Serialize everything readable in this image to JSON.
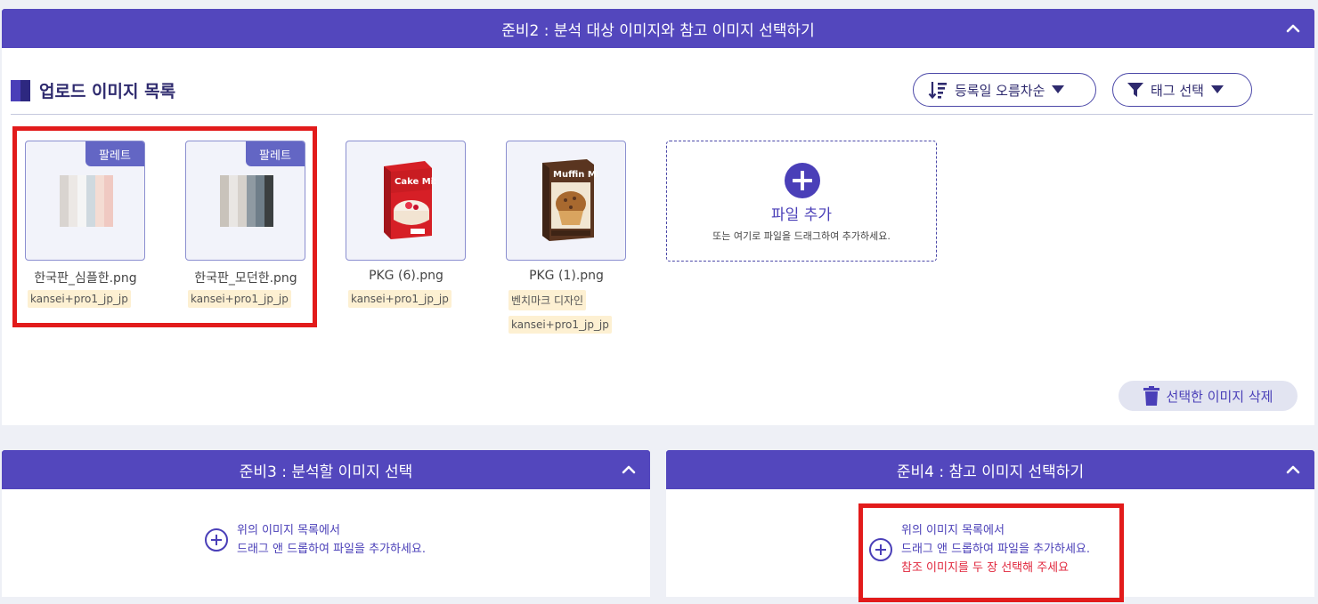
{
  "prep2": {
    "title": "준비2 : 분석 대상 이미지와 참고 이미지 선택하기",
    "section_title": "업로드 이미지 목록",
    "sort_label": "등록일 오름차순",
    "tag_filter_label": "태그 선택",
    "images": [
      {
        "name": "한국판_심플한.png",
        "badge": "팔레트",
        "tags": [
          "kansei+pro1_jp_jp"
        ],
        "swatches": [
          "#d9d4d0",
          "#ece8e5",
          "#f5f5f5",
          "#cfd9df",
          "#f4dcd3",
          "#f0c9c2"
        ]
      },
      {
        "name": "한국판_모던한.png",
        "badge": "팔레트",
        "tags": [
          "kansei+pro1_jp_jp"
        ],
        "swatches": [
          "#c9c3bb",
          "#e9e6e3",
          "#d6d1cb",
          "#8f9aa2",
          "#6f7e89",
          "#3b3f40"
        ]
      },
      {
        "name": "PKG (6).png",
        "badge": "",
        "tags": [
          "kansei+pro1_jp_jp"
        ],
        "box_text": "Cake Mix"
      },
      {
        "name": "PKG (1).png",
        "badge": "",
        "tags": [
          "벤치마크 디자인",
          "kansei+pro1_jp_jp"
        ],
        "box_text": "Muffin Mix"
      }
    ],
    "dropzone": {
      "label": "파일 추가",
      "hint": "또는 여기로 파일을 드래그하여 추가하세요."
    },
    "delete_label": "선택한 이미지 삭제"
  },
  "prep3": {
    "title": "준비3 : 분석할 이미지 선택",
    "hint_line1": "위의 이미지 목록에서",
    "hint_line2": "드래그 앤 드롭하여 파일을 추가하세요."
  },
  "prep4": {
    "title": "준비4 : 참고 이미지 선택하기",
    "hint_line1": "위의 이미지 목록에서",
    "hint_line2": "드래그 앤 드롭하여 파일을 추가하세요.",
    "warning": "참조 이미지를 두 장 선택해 주세요"
  },
  "colors": {
    "accent": "#5347bd",
    "highlight": "#e21b1b",
    "tag_bg": "#fdf0d2",
    "warning": "#e0263c"
  }
}
